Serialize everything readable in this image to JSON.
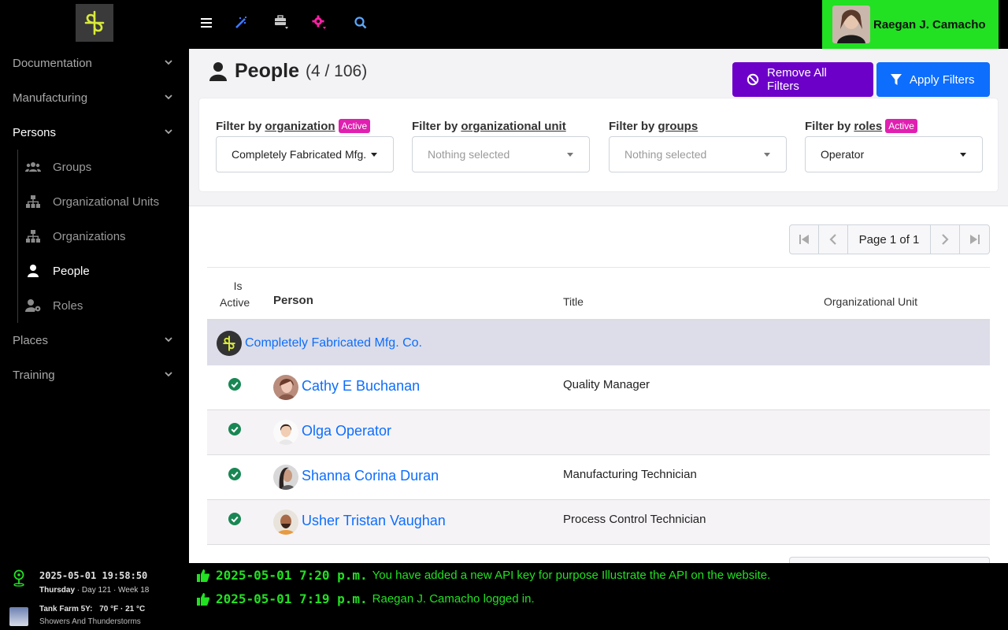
{
  "sidebar": {
    "items": [
      {
        "label": "Documentation"
      },
      {
        "label": "Manufacturing"
      },
      {
        "label": "Persons"
      },
      {
        "label": "Places"
      },
      {
        "label": "Training"
      }
    ],
    "sub_items": [
      {
        "label": "Groups",
        "icon": "users-icon"
      },
      {
        "label": "Organizational Units",
        "icon": "sitemap-icon"
      },
      {
        "label": "Organizations",
        "icon": "sitemap-icon"
      },
      {
        "label": "People",
        "icon": "user-icon"
      },
      {
        "label": "Roles",
        "icon": "user-gear-icon"
      }
    ],
    "active_item": "Persons",
    "active_sub_item": "People"
  },
  "topbar": {
    "icons": [
      "menu-icon",
      "magic-wand-icon",
      "toolbox-icon",
      "gear-icon",
      "search-icon"
    ],
    "user_name": "Raegan J. Camacho"
  },
  "header": {
    "title": "People",
    "count": "(4 / 106)",
    "remove_filters_label": "Remove All Filters",
    "apply_filters_label": "Apply Filters"
  },
  "filters": [
    {
      "prefix": "Filter by",
      "field": "organization",
      "badge": "Active",
      "value": "Completely Fabricated Mfg."
    },
    {
      "prefix": "Filter by",
      "field": "organizational unit",
      "badge": "",
      "value": "Nothing selected"
    },
    {
      "prefix": "Filter by",
      "field": "groups",
      "badge": "",
      "value": "Nothing selected"
    },
    {
      "prefix": "Filter by",
      "field": "roles",
      "badge": "Active",
      "value": "Operator"
    }
  ],
  "pager": {
    "label": "Page 1 of 1"
  },
  "table": {
    "columns": {
      "active_line1": "Is",
      "active_line2": "Active",
      "person": "Person",
      "title": "Title",
      "unit": "Organizational Unit"
    },
    "group": "Completely Fabricated Mfg. Co.",
    "rows": [
      {
        "name": "Cathy E Buchanan",
        "title": "Quality Manager",
        "active": true
      },
      {
        "name": "Olga Operator",
        "title": "",
        "active": true
      },
      {
        "name": "Shanna Corina Duran",
        "title": "Manufacturing Technician",
        "active": true
      },
      {
        "name": "Usher Tristan Vaughan",
        "title": "Process Control Technician",
        "active": true
      }
    ]
  },
  "footer": {
    "clock": "2025-05-01 19:58:50",
    "day": "Thursday",
    "day_num": "Day 121",
    "week": "Week 18",
    "weather_place": "Tank Farm 5Y:",
    "weather_temp": "70 °F · 21 °C",
    "weather_desc": "Showers And Thunderstorms",
    "logs": [
      {
        "time": "2025-05-01 7:20 p.m.",
        "text": "You have added a new API key for purpose Illustrate the API on the website."
      },
      {
        "time": "2025-05-01 7:19 p.m.",
        "text": "Raegan J. Camacho logged in."
      }
    ]
  },
  "colors": {
    "accent": "#0d6efd",
    "remove_button": "#6c00c9",
    "active_badge": "#e020b0",
    "user_box": "#22e022",
    "log_text": "#22e022",
    "check": "#198754"
  }
}
